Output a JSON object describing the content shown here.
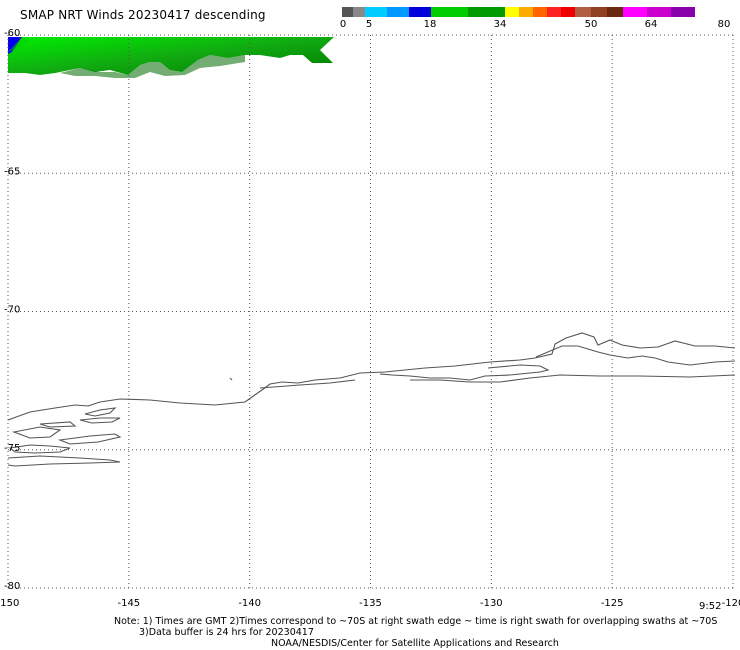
{
  "title": "SMAP NRT Winds  20230417 descending",
  "colorbar": {
    "labels": [
      "0",
      "5",
      "18",
      "34",
      "50",
      "64",
      "80"
    ],
    "segments": [
      {
        "color": "#555555",
        "width": 11
      },
      {
        "color": "#888888",
        "width": 12
      },
      {
        "color": "#00ccff",
        "width": 22
      },
      {
        "color": "#0099ff",
        "width": 22
      },
      {
        "color": "#0000dd",
        "width": 22
      },
      {
        "color": "#00cc00",
        "width": 37
      },
      {
        "color": "#009900",
        "width": 37
      },
      {
        "color": "#ffff00",
        "width": 14
      },
      {
        "color": "#ffaa00",
        "width": 14
      },
      {
        "color": "#ff6600",
        "width": 14
      },
      {
        "color": "#ff2222",
        "width": 14
      },
      {
        "color": "#ee0000",
        "width": 14
      },
      {
        "color": "#b06040",
        "width": 16
      },
      {
        "color": "#904020",
        "width": 16
      },
      {
        "color": "#6a2a10",
        "width": 16
      },
      {
        "color": "#ff00ff",
        "width": 24
      },
      {
        "color": "#cc00cc",
        "width": 24
      },
      {
        "color": "#8800aa",
        "width": 24
      }
    ]
  },
  "map": {
    "lon_range": [
      -150,
      -120
    ],
    "lat_range": [
      -80,
      -60
    ],
    "lon_ticks": [
      "-150",
      "-145",
      "-140",
      "-135",
      "-130",
      "-125",
      "-120"
    ],
    "lat_ticks": [
      "-60",
      "-65",
      "-70",
      "-75",
      "-80"
    ],
    "grid": true,
    "wind_swath_colors": [
      "#0000ee",
      "#00dd00",
      "#11aa11",
      "#006600"
    ]
  },
  "time_label": "9:52",
  "notes": {
    "line1": "Note: 1) Times are GMT 2)Times correspond to ~70S at right swath edge ~ time is right swath for overlapping swaths at ~70S",
    "line2": "3)Data buffer is 24 hrs for 20230417",
    "line3": "NOAA/NESDIS/Center for Satellite Applications and Research"
  }
}
